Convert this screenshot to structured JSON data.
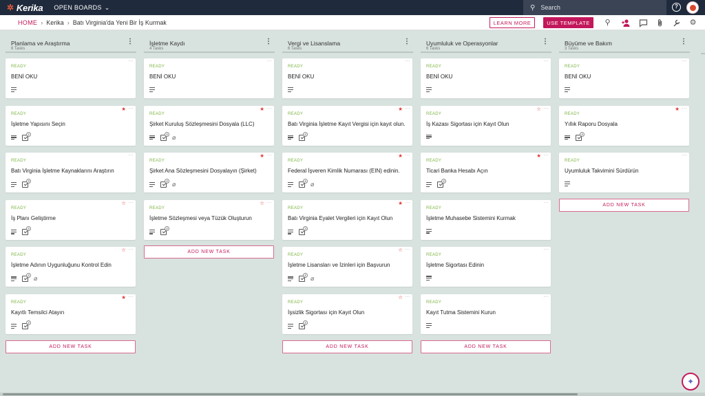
{
  "app": {
    "logo": "Kerika",
    "open_boards": "OPEN BOARDS",
    "search_placeholder": "Search",
    "help_label": "?"
  },
  "breadcrumb": {
    "home": "HOME",
    "org": "Kerika",
    "board": "Batı Virginia'da Yeni Bir İş Kurmak"
  },
  "actions": {
    "learn_more": "LEARN MORE",
    "use_template": "USE TEMPLATE"
  },
  "add_task_label": "ADD NEW TASK",
  "columns": [
    {
      "title": "Planlama ve Araştırma",
      "count": "6 Tasks",
      "cards": [
        {
          "status": "READY",
          "title": "BENİ OKU",
          "star": "none",
          "checklist": "",
          "attach": false
        },
        {
          "status": "READY",
          "title": "İşletme Yapısını Seçin",
          "star": "on",
          "checklist": "2",
          "attach": false
        },
        {
          "status": "READY",
          "title": "Batı Virginia İşletme Kaynaklarını Araştırın",
          "star": "none",
          "checklist": "3",
          "attach": false
        },
        {
          "status": "READY",
          "title": "İş Planı Geliştirme",
          "star": "off",
          "checklist": "4",
          "attach": false
        },
        {
          "status": "READY",
          "title": "İşletme Adının Uygunluğunu Kontrol Edin",
          "star": "off",
          "checklist": "4",
          "attach": true
        },
        {
          "status": "READY",
          "title": "Kayıtlı Temsilci Atayın",
          "star": "on",
          "checklist": "2",
          "attach": false
        }
      ]
    },
    {
      "title": "İşletme Kaydı",
      "count": "4 Tasks",
      "cards": [
        {
          "status": "READY",
          "title": "BENİ OKU",
          "star": "none",
          "checklist": "",
          "attach": false
        },
        {
          "status": "READY",
          "title": "Şirket Kuruluş Sözleşmesini Dosyala (LLC)",
          "star": "on",
          "checklist": "4",
          "attach": true
        },
        {
          "status": "READY",
          "title": "Şirket Ana Sözleşmesini Dosyalayın (Şirket)",
          "star": "on",
          "checklist": "4",
          "attach": true
        },
        {
          "status": "READY",
          "title": "İşletme Sözleşmesi veya Tüzük Oluşturun",
          "star": "off",
          "checklist": "4",
          "attach": false
        }
      ]
    },
    {
      "title": "Vergi ve Lisanslama",
      "count": "6 Tasks",
      "cards": [
        {
          "status": "READY",
          "title": "BENİ OKU",
          "star": "none",
          "checklist": "",
          "attach": false
        },
        {
          "status": "READY",
          "title": "Batı Virginia İşletme Kayıt Vergisi için kayıt olun.",
          "star": "on",
          "checklist": "4",
          "attach": false
        },
        {
          "status": "READY",
          "title": "Federal İşveren Kimlik Numarası (EIN) edinin.",
          "star": "on",
          "checklist": "4",
          "attach": true
        },
        {
          "status": "READY",
          "title": "Batı Virginia Eyalet Vergileri için Kayıt Olun",
          "star": "on",
          "checklist": "3",
          "attach": false
        },
        {
          "status": "READY",
          "title": "İşletme Lisansları ve İzinleri için Başvurun",
          "star": "off",
          "checklist": "4",
          "attach": true
        },
        {
          "status": "READY",
          "title": "İşsizlik Sigortası için Kayıt Olun",
          "star": "off",
          "checklist": "4",
          "attach": false
        }
      ]
    },
    {
      "title": "Uyumluluk ve Operasyonlar",
      "count": "6 Tasks",
      "cards": [
        {
          "status": "READY",
          "title": "BENİ OKU",
          "star": "none",
          "checklist": "",
          "attach": false
        },
        {
          "status": "READY",
          "title": "İş Kazası Sigortası için Kayıt Olun",
          "star": "off",
          "checklist": "",
          "attach": false
        },
        {
          "status": "READY",
          "title": "Ticari Banka Hesabı Açın",
          "star": "on",
          "checklist": "4",
          "attach": false
        },
        {
          "status": "READY",
          "title": "İşletme Muhasebe Sistemini Kurmak",
          "star": "none",
          "checklist": "",
          "attach": false
        },
        {
          "status": "READY",
          "title": "İşletme Sigortası Edinin",
          "star": "none",
          "checklist": "",
          "attach": false
        },
        {
          "status": "READY",
          "title": "Kayıt Tutma Sistemini Kurun",
          "star": "none",
          "checklist": "",
          "attach": false
        }
      ]
    },
    {
      "title": "Büyüme ve Bakım",
      "count": "3 Tasks",
      "cards": [
        {
          "status": "READY",
          "title": "BENİ OKU",
          "star": "none",
          "checklist": "",
          "attach": false
        },
        {
          "status": "READY",
          "title": "Yıllık Raporu Dosyala",
          "star": "on",
          "checklist": "4",
          "attach": false
        },
        {
          "status": "READY",
          "title": "Uyumluluk Takvimini Sürdürün",
          "star": "none",
          "checklist": "",
          "attach": false
        }
      ]
    }
  ],
  "colors": {
    "accent": "#c2185b",
    "ready": "#7cb342",
    "topbar": "#1f2a3c",
    "board_bg": "#d8e2de"
  }
}
